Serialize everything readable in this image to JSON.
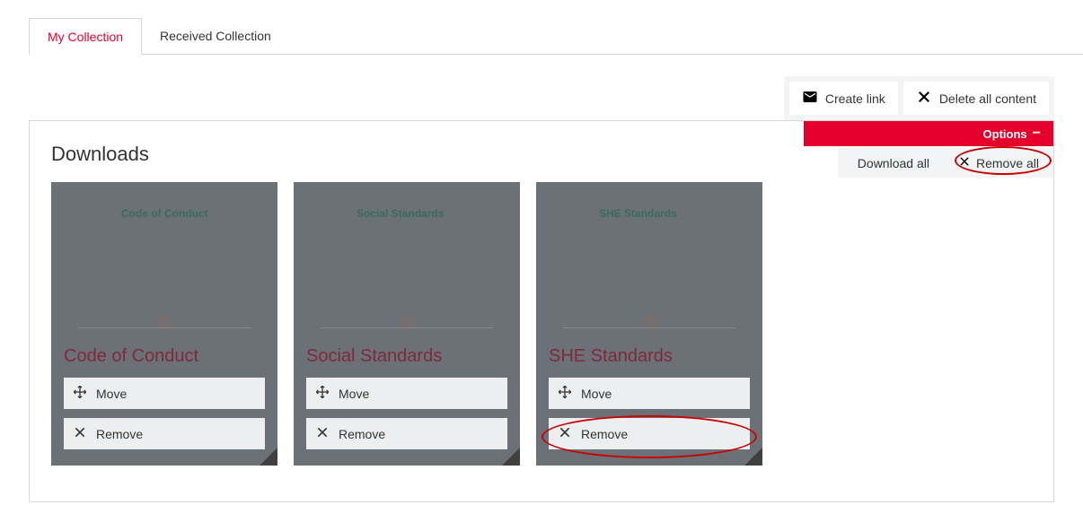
{
  "tabs": {
    "my_collection": "My Collection",
    "received_collection": "Received Collection"
  },
  "toolbar": {
    "create_link": "Create link",
    "delete_all": "Delete all content"
  },
  "options": {
    "label": "Options",
    "download_all": "Download all",
    "remove_all": "Remove all"
  },
  "section_title": "Downloads",
  "cards": [
    {
      "doc_label": "Code of Conduct",
      "title": "Code of Conduct",
      "move": "Move",
      "remove": "Remove"
    },
    {
      "doc_label": "Social Standards",
      "title": "Social Standards",
      "move": "Move",
      "remove": "Remove"
    },
    {
      "doc_label": "SHE Standards",
      "title": "SHE Standards",
      "move": "Move",
      "remove": "Remove"
    }
  ]
}
